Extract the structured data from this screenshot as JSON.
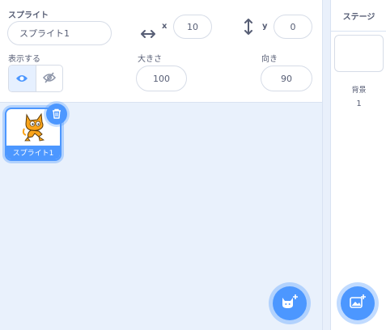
{
  "sprite_info": {
    "sprite_label": "スプライト",
    "sprite_name": "スプライト1",
    "x_label": "x",
    "x_value": "10",
    "y_label": "y",
    "y_value": "0",
    "show_label": "表示する",
    "size_label": "大きさ",
    "size_value": "100",
    "direction_label": "向き",
    "direction_value": "90"
  },
  "sprite_list": {
    "items": [
      {
        "name": "スプライト1",
        "selected": true
      }
    ]
  },
  "stage": {
    "title": "ステージ",
    "backdrop_label": "背景",
    "backdrop_count": "1"
  },
  "colors": {
    "accent": "#4c97ff",
    "text": "#575e75",
    "pane_bg": "#e9f1fc"
  },
  "icons": {
    "x_arrows": "horizontal-arrows-icon",
    "y_arrows": "vertical-arrows-icon",
    "show": "eye-icon",
    "hide": "eye-slash-icon",
    "delete": "trash-icon",
    "add_sprite": "cat-plus-icon",
    "add_backdrop": "image-plus-icon"
  }
}
